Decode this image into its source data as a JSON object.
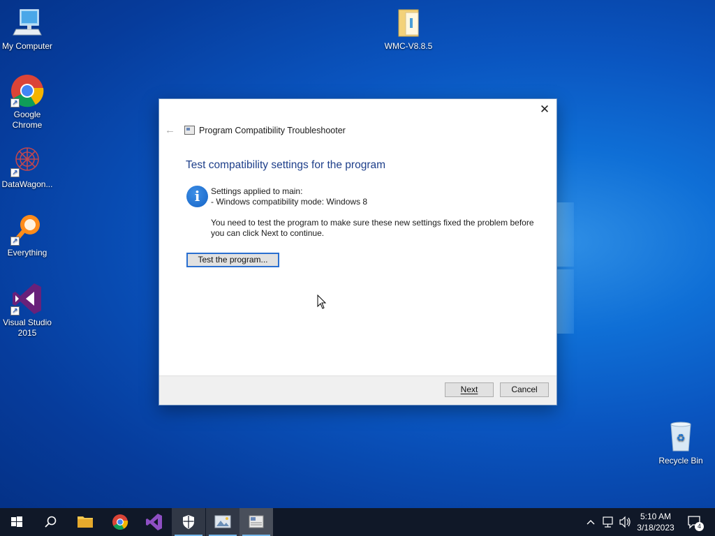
{
  "desktop": {
    "icons": [
      {
        "label": "My Computer",
        "icon": "computer-icon"
      },
      {
        "label": "Google Chrome",
        "icon": "chrome-icon"
      },
      {
        "label": "DataWagon...",
        "icon": "datawagon-icon"
      },
      {
        "label": "Everything",
        "icon": "everything-icon"
      },
      {
        "label": "Visual Studio 2015",
        "icon": "visual-studio-icon"
      },
      {
        "label": "WMC-V8.8.5",
        "icon": "folder-icon"
      },
      {
        "label": "Recycle Bin",
        "icon": "recycle-bin-icon"
      }
    ]
  },
  "dialog": {
    "close_glyph": "✕",
    "back_glyph": "←",
    "app_title": "Program Compatibility Troubleshooter",
    "heading": "Test compatibility settings for the program",
    "settings_line": "Settings applied to main:",
    "mode_line": "- Windows compatibility mode: Windows 8",
    "instructions_line1": "You need to test the program to make sure these new settings fixed the problem before",
    "instructions_line2": "you can click Next to continue.",
    "test_button": "Test the program...",
    "next_button": "Next",
    "cancel_button": "Cancel"
  },
  "taskbar": {
    "items": [
      "start-icon",
      "search-icon",
      "file-explorer-icon",
      "chrome-icon",
      "visual-studio-icon",
      "windows-security-icon",
      "image-viewer-icon",
      "troubleshooter-icon"
    ],
    "active_item": "troubleshooter-icon",
    "clock_time": "5:10 AM",
    "clock_date": "3/18/2023",
    "notification_count": "4"
  },
  "colors": {
    "heading": "#1e3f8a",
    "accent": "#2a6fd0",
    "taskbar": "#101828"
  }
}
